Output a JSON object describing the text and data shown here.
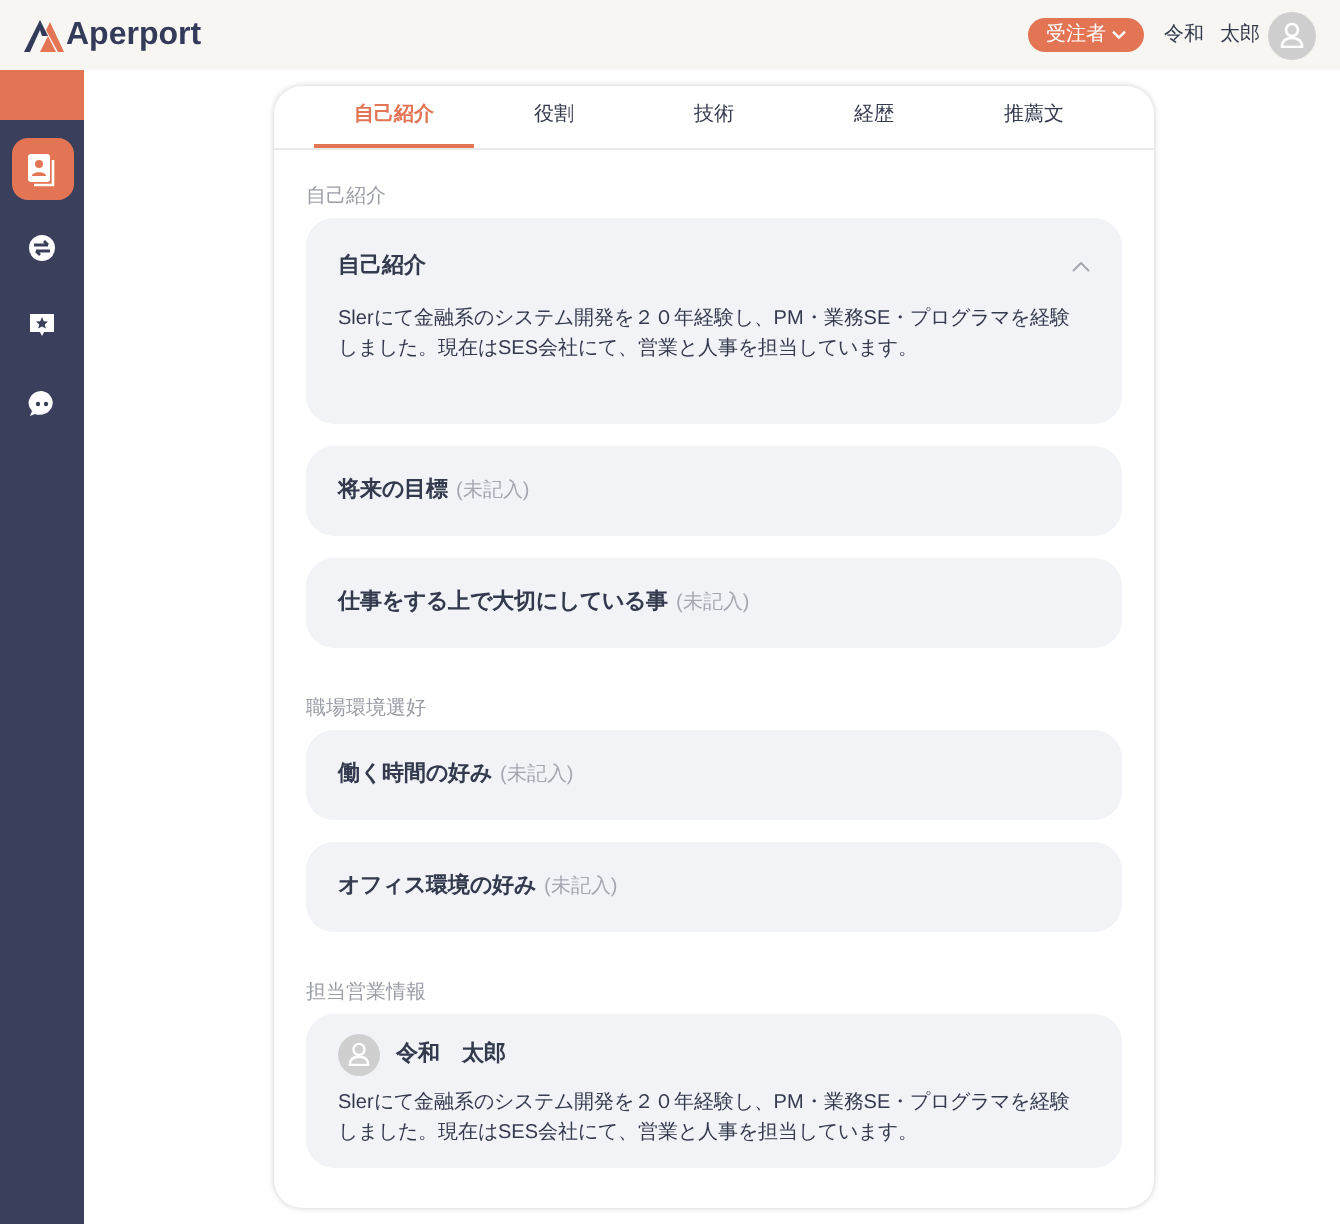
{
  "header": {
    "logo": "Aperport",
    "role_button": "受注者",
    "user_family_name": "令和",
    "user_given_name": "太郎"
  },
  "sidebar": {
    "items": [
      {
        "selected": true
      },
      {
        "selected": false
      },
      {
        "selected": false
      },
      {
        "selected": false
      }
    ]
  },
  "tabs": [
    {
      "label": "自己紹介",
      "selected": true
    },
    {
      "label": "役割",
      "selected": false
    },
    {
      "label": "技術",
      "selected": false
    },
    {
      "label": "経歴",
      "selected": false
    },
    {
      "label": "推薦文",
      "selected": false
    }
  ],
  "sections": [
    {
      "title": "自己紹介",
      "cards": [
        {
          "kind": "accordion",
          "title": "自己紹介",
          "expanded": true,
          "body": "Slerにて金融系のシステム開発を２０年経験し、PM・業務SE・プログラマを経験しました。現在はSES会社にて、営業と人事を担当しています。"
        },
        {
          "kind": "accordion",
          "title": "将来の目標",
          "expanded": false,
          "note": "(未記入)"
        },
        {
          "kind": "accordion",
          "title": "仕事をする上で大切にしている事",
          "expanded": false,
          "note": "(未記入)"
        }
      ]
    },
    {
      "title": "職場環境選好",
      "cards": [
        {
          "kind": "accordion",
          "title": "働く時間の好み",
          "expanded": false,
          "note": "(未記入)"
        },
        {
          "kind": "accordion",
          "title": "オフィス環境の好み",
          "expanded": false,
          "note": "(未記入)"
        }
      ]
    },
    {
      "title": "担当営業情報",
      "cards": [
        {
          "kind": "profile",
          "name": "令和　太郎",
          "body": "Slerにて金融系のシステム開発を２０年経験し、PM・業務SE・プログラマを経験しました。現在はSES会社にて、営業と人事を担当しています。"
        }
      ]
    }
  ]
}
